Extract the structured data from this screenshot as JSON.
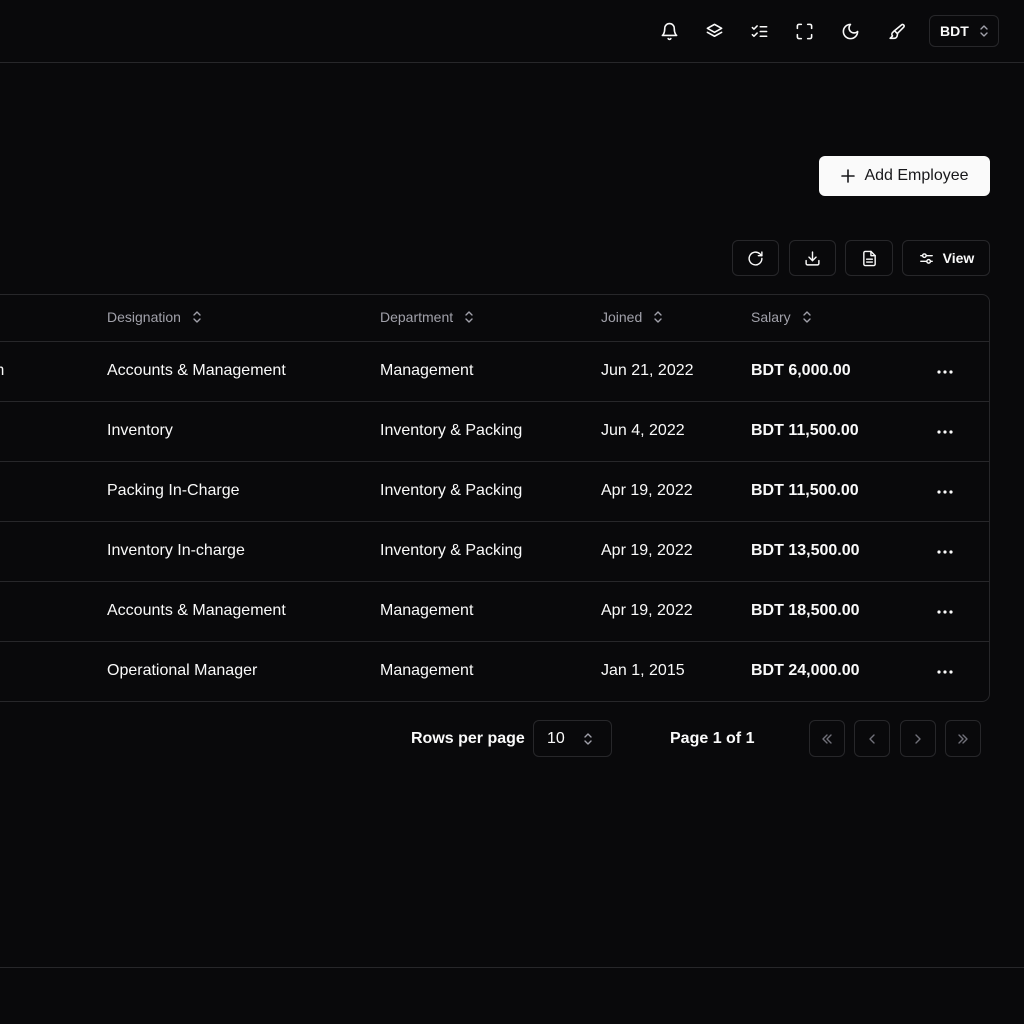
{
  "header": {
    "icons": [
      {
        "name": "bell-icon"
      },
      {
        "name": "layers-icon"
      },
      {
        "name": "checklist-icon"
      },
      {
        "name": "fullscreen-icon"
      },
      {
        "name": "moon-icon"
      },
      {
        "name": "paintbrush-icon"
      }
    ],
    "currency": "BDT"
  },
  "actions": {
    "add_employee_label": "Add Employee",
    "view_label": "View"
  },
  "table": {
    "columns": [
      "Designation",
      "Department",
      "Joined",
      "Salary"
    ],
    "rows": [
      {
        "name_partial": "m",
        "designation": "Accounts & Management",
        "department": "Management",
        "joined": "Jun 21, 2022",
        "salary": "BDT 6,000.00"
      },
      {
        "name_partial": "",
        "designation": "Inventory",
        "department": "Inventory & Packing",
        "joined": "Jun 4, 2022",
        "salary": "BDT 11,500.00"
      },
      {
        "name_partial": "",
        "designation": "Packing In-Charge",
        "department": "Inventory & Packing",
        "joined": "Apr 19, 2022",
        "salary": "BDT 11,500.00"
      },
      {
        "name_partial": "",
        "designation": "Inventory In-charge",
        "department": "Inventory & Packing",
        "joined": "Apr 19, 2022",
        "salary": "BDT 13,500.00"
      },
      {
        "name_partial": "",
        "designation": "Accounts & Management",
        "department": "Management",
        "joined": "Apr 19, 2022",
        "salary": "BDT 18,500.00"
      },
      {
        "name_partial": "",
        "designation": "Operational Manager",
        "department": "Management",
        "joined": "Jan 1, 2015",
        "salary": "BDT 24,000.00"
      }
    ]
  },
  "pagination": {
    "rows_per_page_label": "Rows per page",
    "rows_per_page_value": "10",
    "page_label": "Page 1 of 1"
  },
  "colors": {
    "background": "#09090b",
    "border": "#27272a",
    "text": "#fafafa",
    "muted": "#a1a1aa",
    "primary_button": "#fafafa"
  }
}
